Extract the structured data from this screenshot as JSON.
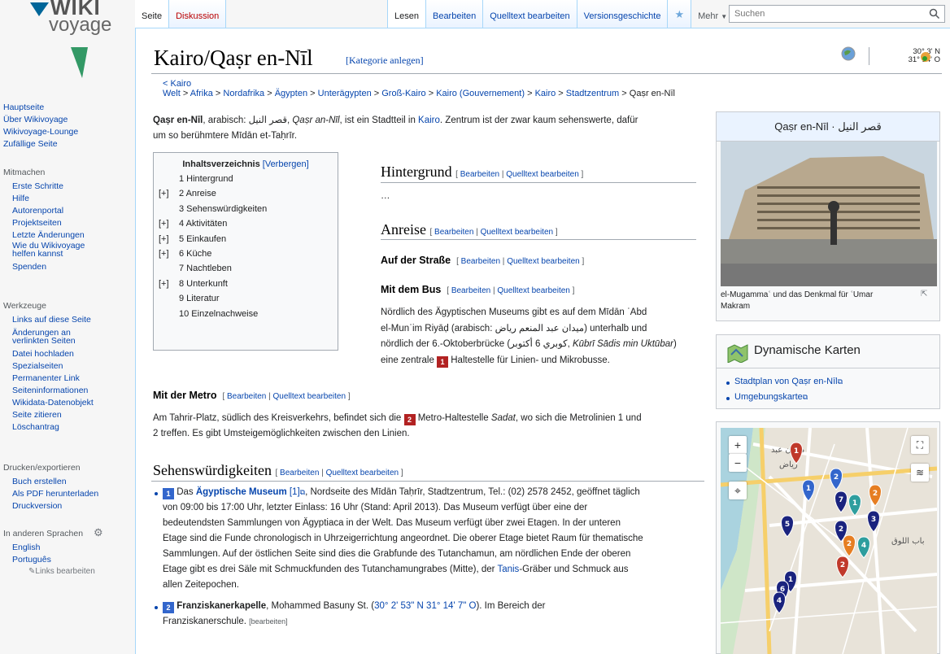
{
  "logo": {
    "line1": "WIKI",
    "line2": "voyage"
  },
  "nav": [
    {
      "label": "Hauptseite"
    },
    {
      "label": "Über Wikivoyage"
    },
    {
      "label": "Wikivoyage-Lounge"
    },
    {
      "label": "Zufällige Seite"
    }
  ],
  "mitmachen": {
    "heading": "Mitmachen",
    "items": [
      {
        "label": "Erste Schritte"
      },
      {
        "label": "Hilfe"
      },
      {
        "label": "Autorenportal"
      },
      {
        "label": "Projektseiten"
      },
      {
        "label": "Letzte Änderungen"
      },
      {
        "label": "Wie du Wikivoyage"
      },
      {
        "label": "helfen kannst"
      },
      {
        "label": "Spenden"
      }
    ]
  },
  "werkzeuge": {
    "heading": "Werkzeuge",
    "items": [
      {
        "label": "Links auf diese Seite"
      },
      {
        "label": "Änderungen an"
      },
      {
        "label": "verlinkten Seiten"
      },
      {
        "label": "Datei hochladen"
      },
      {
        "label": "Spezialseiten"
      },
      {
        "label": "Permanenter Link"
      },
      {
        "label": "Seiteninformationen"
      },
      {
        "label": "Wikidata-Datenobjekt"
      },
      {
        "label": "Seite zitieren"
      },
      {
        "label": "Löschantrag"
      }
    ]
  },
  "drucken": {
    "heading": "Drucken/exportieren",
    "items": [
      {
        "label": "Buch erstellen"
      },
      {
        "label": "Als PDF herunterladen"
      },
      {
        "label": "Druckversion"
      }
    ]
  },
  "sprachen": {
    "heading": "In anderen Sprachen",
    "items": [
      {
        "label": "English"
      },
      {
        "label": "Português"
      }
    ],
    "edit": "Links bearbeiten"
  },
  "tabs_left": [
    {
      "label": "Seite",
      "state": "selected"
    },
    {
      "label": "Diskussion",
      "state": "new"
    }
  ],
  "tabs_right": [
    {
      "label": "Lesen",
      "state": "selected"
    },
    {
      "label": "Bearbeiten"
    },
    {
      "label": "Quelltext bearbeiten"
    },
    {
      "label": "Versionsgeschichte"
    }
  ],
  "more": "Mehr",
  "search": {
    "placeholder": "Suchen"
  },
  "title": "Kairo/Qaṣr en-Nīl",
  "category_link": "[Kategorie anlegen]",
  "coords": "30° 3' N\n31° 14' O",
  "breadcrumb": {
    "up": "< Kairo",
    "trail": [
      "Welt",
      "Afrika",
      "Nordafrika",
      "Ägypten",
      "Unterägypten",
      "Groß-Kairo",
      "Kairo (Gouvernement)",
      "Kairo",
      "Stadtzentrum"
    ],
    "current": "Qaṣr en-Nīl",
    "sep": " > "
  },
  "intro": {
    "bold": "Qaṣr en-Nīl",
    "p1": ", arabisch: قصر النيل, ",
    "italic": "Qaṣr an-Nīl",
    "p2": ", ist ein Stadtteil in ",
    "link": "Kairo",
    "p3": ". Zentrum ist der zwar kaum sehenswerte, dafür",
    "line2": "um so berühmtere Mīdān et-Taḥrīr."
  },
  "toc": {
    "title": "Inhaltsverzeichnis",
    "toggle": "[Verbergen]",
    "items": [
      {
        "plus": "",
        "label": "1 Hintergrund"
      },
      {
        "plus": "[+]",
        "label": "2 Anreise"
      },
      {
        "plus": "",
        "label": "3 Sehenswürdigkeiten"
      },
      {
        "plus": "[+]",
        "label": "4 Aktivitäten"
      },
      {
        "plus": "[+]",
        "label": "5 Einkaufen"
      },
      {
        "plus": "[+]",
        "label": "6 Küche"
      },
      {
        "plus": "",
        "label": "7 Nachtleben"
      },
      {
        "plus": "[+]",
        "label": "8 Unterkunft"
      },
      {
        "plus": "",
        "label": "9 Literatur"
      },
      {
        "plus": "",
        "label": "10 Einzelnachweise"
      }
    ]
  },
  "edit": {
    "open": "[ ",
    "edit": "Bearbeiten",
    "sep": " | ",
    "source": "Quelltext bearbeiten",
    "close": " ]"
  },
  "sections": {
    "hintergrund": {
      "title": "Hintergrund",
      "text": "…"
    },
    "anreise": {
      "title": "Anreise"
    },
    "strasse": {
      "title": "Auf der Straße"
    },
    "bus": {
      "title": "Mit dem Bus",
      "l1": "Nördlich des Ägyptischen Museums gibt es auf dem Mīdān ʿAbd",
      "l2": "el-Munʿim Riyāḍ (arabisch: ميدان عبد المنعم رياض) unterhalb und",
      "l3a": "nördlich der 6.-Oktoberbrücke (كوبري 6 أكتوبر, ",
      "l3i": "Kūbrī Sādis min Uktūbar",
      "l3b": ")",
      "l4a": "eine zentrale ",
      "l4m": "1",
      "l4b": " Haltestelle für Linien- und Mikrobusse."
    },
    "metro": {
      "title": "Mit der Metro",
      "l1a": "Am Tahrir-Platz, südlich des Kreisverkehrs, befindet sich die ",
      "l1m": "2",
      "l1b": " Metro-Haltestelle ",
      "l1i": "Sadat",
      "l1c": ", wo sich die Metrolinien 1 und",
      "l2": "2 treffen. Es gibt Umsteigemöglichkeiten zwischen den Linien."
    },
    "sehens": {
      "title": "Sehenswürdigkeiten"
    }
  },
  "listings": [
    {
      "num": "1",
      "pre": " Das ",
      "name": "Ägyptische Museum",
      "ref": " [1]",
      "l1": ", Nordseite des Mīdān Taḥrīr, Stadtzentrum, Tel.: (02) 2578 2452, geöffnet täglich",
      "lines": [
        "von 09:00 bis 17:00 Uhr, letzter Einlass: 16 Uhr (Stand: April 2013). Das Museum verfügt über eine der",
        "bedeutendsten Sammlungen von Ägyptiaca in der Welt. Das Museum verfügt über zwei Etagen. In der unteren",
        "Etage sind die Funde chronologisch in Uhrzeigerrichtung angeordnet. Die oberer Etage bietet Raum für thematische",
        "Sammlungen. Auf der östlichen Seite sind dies die Grabfunde des Tutanchamun, am nördlichen Ende der oberen"
      ],
      "l6a": "Etage gibt es drei Säle mit Schmuckfunden des Tutanchamungrabes (Mitte), der ",
      "l6l": "Tanis",
      "l6b": "-Gräber und Schmuck aus",
      "l7": "allen Zeitepochen."
    },
    {
      "num": "2",
      "name": "Franziskanerkapelle",
      "a": ", Mohammed Basuny St. (",
      "coord": "30° 2' 53\" N 31° 14' 7\" O",
      "b": "). Im Bereich der",
      "l2": "Franziskanerschule.",
      "edit": "[bearbeiten]"
    }
  ],
  "infobox": {
    "title": "Qaṣr en-Nīl · قصر النيل",
    "caption1": "el-Mugammaʿ und das Denkmal für ʿUmar",
    "caption2": "Makram"
  },
  "maps": {
    "title": "Dynamische Karten",
    "links": [
      {
        "label": "Stadtplan von Qaṣr en-Nīl"
      },
      {
        "label": "Umgebungskarte"
      }
    ]
  },
  "map": {
    "labels": [
      "ميدان عبد",
      "رياض",
      "باب اللوق"
    ],
    "markers": [
      {
        "n": "1",
        "c": "#c0392b"
      },
      {
        "n": "2",
        "c": "#3366cc"
      },
      {
        "n": "1",
        "c": "#3366cc"
      },
      {
        "n": "5",
        "c": "#1a237e"
      },
      {
        "n": "7",
        "c": "#1a237e"
      },
      {
        "n": "1",
        "c": "#2e9e9e"
      },
      {
        "n": "2",
        "c": "#e67e22"
      },
      {
        "n": "3",
        "c": "#1a237e"
      },
      {
        "n": "2",
        "c": "#1a237e"
      },
      {
        "n": "2",
        "c": "#e67e22"
      },
      {
        "n": "4",
        "c": "#2e9e9e"
      },
      {
        "n": "2",
        "c": "#c0392b"
      },
      {
        "n": "1",
        "c": "#1a237e"
      },
      {
        "n": "6",
        "c": "#1a237e"
      },
      {
        "n": "4",
        "c": "#1a237e"
      }
    ],
    "zoom_in": "+",
    "zoom_out": "−"
  },
  "colors": {
    "marker_red": "#b22222",
    "marker_blue": "#3366cc",
    "link": "#0645ad"
  }
}
